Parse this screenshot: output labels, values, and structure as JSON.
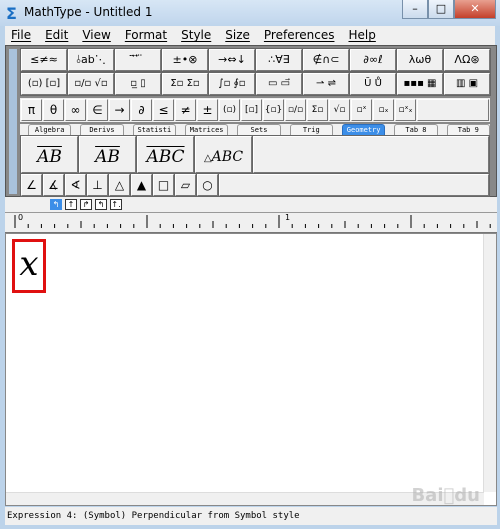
{
  "window": {
    "title": "MathType - Untitled 1",
    "icon": "sigma-icon",
    "controls": [
      "minimize",
      "maximize",
      "close"
    ]
  },
  "menu": [
    "File",
    "Edit",
    "View",
    "Format",
    "Style",
    "Size",
    "Preferences",
    "Help"
  ],
  "palette": {
    "row1": [
      "≤≠≈",
      "⫰ab⋱",
      "⃗̈ ⃗ ⃛",
      "±•⊗",
      "→⇔↓",
      "∴∀∃",
      "∉∩⊂",
      "∂∞ℓ",
      "λωθ",
      "ΛΩ⊛"
    ],
    "row2": [
      "(▫) [▫]",
      "▫/▫ √▫",
      "▫̲ ▯",
      "Σ▫ Σ▫",
      "∫▫ ∮▫",
      "▭ ▭⃗",
      "⇀ ⇌",
      "Ū Ů",
      "▪▪▪ ▦",
      "▥ ▣"
    ],
    "row3": [
      "π",
      "θ",
      "∞",
      "∈",
      "→",
      "∂",
      "≤",
      "≠",
      "±",
      "(▫)",
      "[▫]",
      "{▫}",
      "▫/▫",
      "Σ▫",
      "√▫",
      "▫ˣ",
      "▫ₓ",
      "▫ˣₓ"
    ],
    "tabs": [
      "Algebra",
      "Derivs",
      "Statisti",
      "Matrices",
      "Sets",
      "Trig",
      "Geometry",
      "Tab 8",
      "Tab 9"
    ],
    "active_tab": "Geometry",
    "templates": [
      "AB⃗",
      "AB⃡",
      "ABC⌒",
      "△ABC"
    ],
    "template_display": [
      "AB",
      "AB",
      "ABC",
      "ABC"
    ],
    "geometry_symbols": [
      "∠",
      "∡",
      "∢",
      "⊥",
      "△",
      "▲",
      "□",
      "▱",
      "○"
    ]
  },
  "small_toolbar": [
    "↰",
    "↑",
    "↱",
    "↰",
    "↑."
  ],
  "ruler": {
    "labels": [
      "0",
      "1"
    ]
  },
  "editor": {
    "content": "x"
  },
  "status": "Expression 4: (Symbol) Perpendicular from Symbol style",
  "watermark": "Baidu 经验"
}
